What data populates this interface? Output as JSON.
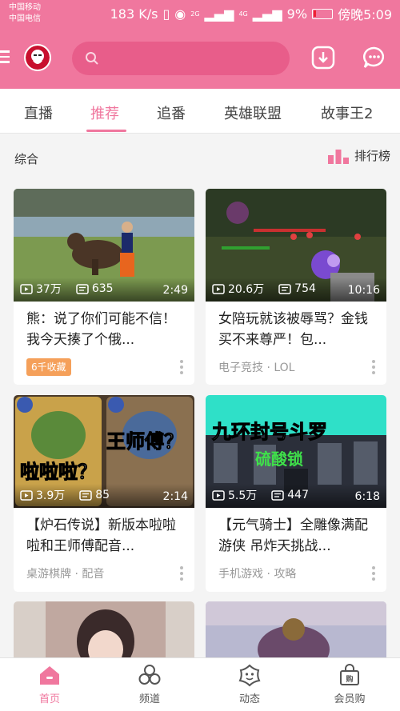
{
  "status_bar": {
    "carrier_1": "中国移动",
    "carrier_2": "中国电信",
    "speed": "183 K/s",
    "net_1": "2G",
    "net_2": "4G",
    "battery": "9%",
    "time": "傍晚5:09"
  },
  "app": {
    "accent_color": "#f0779e",
    "search": {
      "placeholder": ""
    }
  },
  "tabs": [
    {
      "label": "直播"
    },
    {
      "label": "推荐",
      "active": true
    },
    {
      "label": "追番"
    },
    {
      "label": "英雄联盟"
    },
    {
      "label": "故事王2"
    }
  ],
  "section": {
    "title": "综合",
    "rank_label": "排行榜"
  },
  "cards": [
    {
      "views": "37万",
      "danmaku": "635",
      "duration": "2:49",
      "title": "熊：说了你们可能不信！我今天揍了个俄...",
      "tag": "6千收藏"
    },
    {
      "views": "20.6万",
      "danmaku": "754",
      "duration": "10:16",
      "title": "女陪玩就该被辱骂？金钱买不来尊严！包...",
      "meta": "电子竞技 · LOL"
    },
    {
      "views": "3.9万",
      "danmaku": "85",
      "duration": "2:14",
      "title": "【炉石传说】新版本啦啦啦和王师傅配音...",
      "meta": "桌游棋牌 · 配音",
      "thumb_text_1": "啦啦啦？",
      "thumb_text_2": "王师傅？"
    },
    {
      "views": "5.5万",
      "danmaku": "447",
      "duration": "6:18",
      "title": "【元气骑士】全雕像满配游侠 吊炸天挑战...",
      "meta": "手机游戏 · 攻略",
      "thumb_text_1": "九环封号斗罗",
      "thumb_text_2": "硫酸锁"
    }
  ],
  "bottom_nav": [
    {
      "label": "首页",
      "icon": "home-icon",
      "active": true
    },
    {
      "label": "频道",
      "icon": "channel-icon"
    },
    {
      "label": "动态",
      "icon": "dynamic-icon"
    },
    {
      "label": "会员购",
      "icon": "shop-icon"
    }
  ]
}
